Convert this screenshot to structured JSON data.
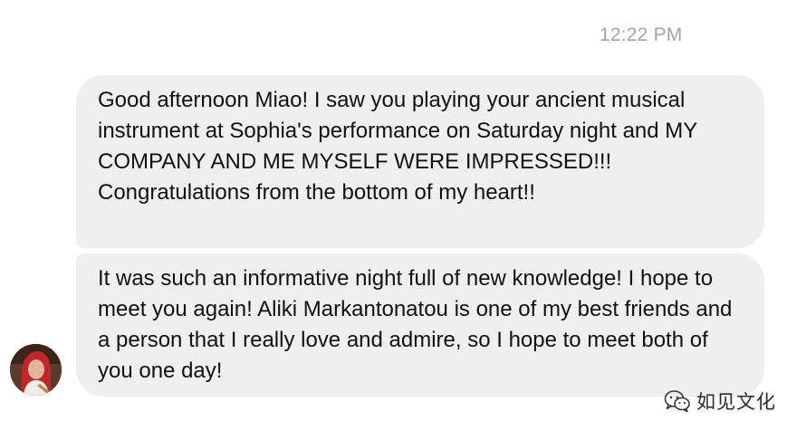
{
  "conversation": {
    "timestamp": "12:22 PM",
    "messages": [
      {
        "sender": "incoming",
        "text": "Good afternoon Miao! I saw you playing your ancient musical instrument at Sophia's performance on Saturday night and MY COMPANY AND ME MYSELF WERE IMPRESSED!!! Congratulations from the bottom of my heart!!"
      },
      {
        "sender": "incoming",
        "text": "It was such an informative night full of new knowledge! I hope to meet you again! Aliki Markantonatou is one of my best friends and a person that I really love and admire, so I hope to meet both of you one day!"
      }
    ],
    "avatar": {
      "icon": "user-avatar",
      "colors": {
        "headscarf": "#c0282d",
        "skin": "#e2b49a",
        "background": "#5a3a2a"
      }
    }
  },
  "watermark": {
    "icon": "wechat-icon",
    "text": "如见文化"
  },
  "colors": {
    "bubble": "#efefef",
    "timestamp": "#a3a3a8",
    "message_text": "#111111"
  }
}
